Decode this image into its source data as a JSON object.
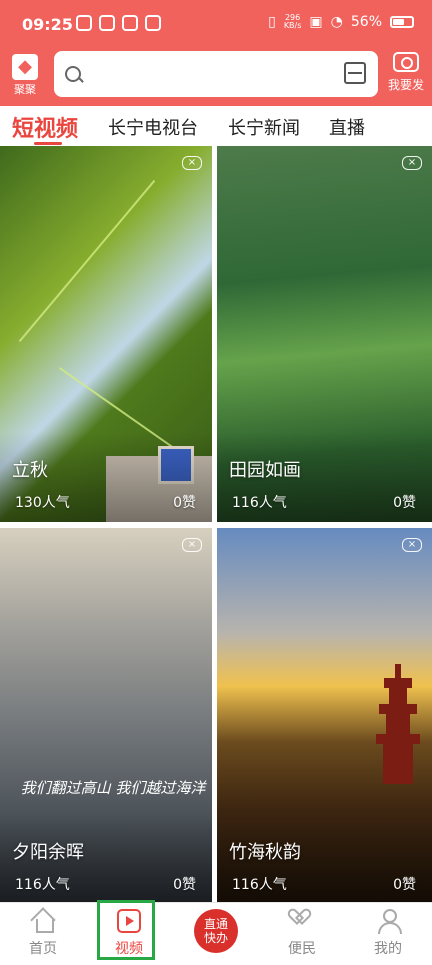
{
  "status_bar": {
    "time": "09:25",
    "network_speed_top": "296",
    "network_speed_bottom": "KB/s",
    "battery_percent": "56%"
  },
  "header": {
    "logo_text": "聚聚",
    "publish_label": "我要发",
    "search_placeholder": ""
  },
  "tabs": [
    {
      "label": "短视频",
      "active": true
    },
    {
      "label": "长宁电视台",
      "active": false
    },
    {
      "label": "长宁新闻",
      "active": false
    },
    {
      "label": "直播",
      "active": false
    }
  ],
  "cards": [
    {
      "title": "立秋",
      "views": "130人气",
      "likes": "0赞"
    },
    {
      "title": "田园如画",
      "views": "116人气",
      "likes": "0赞"
    },
    {
      "title": "夕阳余晖",
      "views": "116人气",
      "likes": "0赞",
      "caption": "我们翻过高山 我们越过海洋"
    },
    {
      "title": "竹海秋韵",
      "views": "116人气",
      "likes": "0赞"
    }
  ],
  "bottom_nav": {
    "home": "首页",
    "video": "视频",
    "fast_line1": "直通",
    "fast_line2": "快办",
    "bianmin": "便民",
    "me": "我的"
  },
  "colors": {
    "brand_red": "#f2625d",
    "active_red": "#e9463f",
    "highlight_green": "#28a745"
  }
}
